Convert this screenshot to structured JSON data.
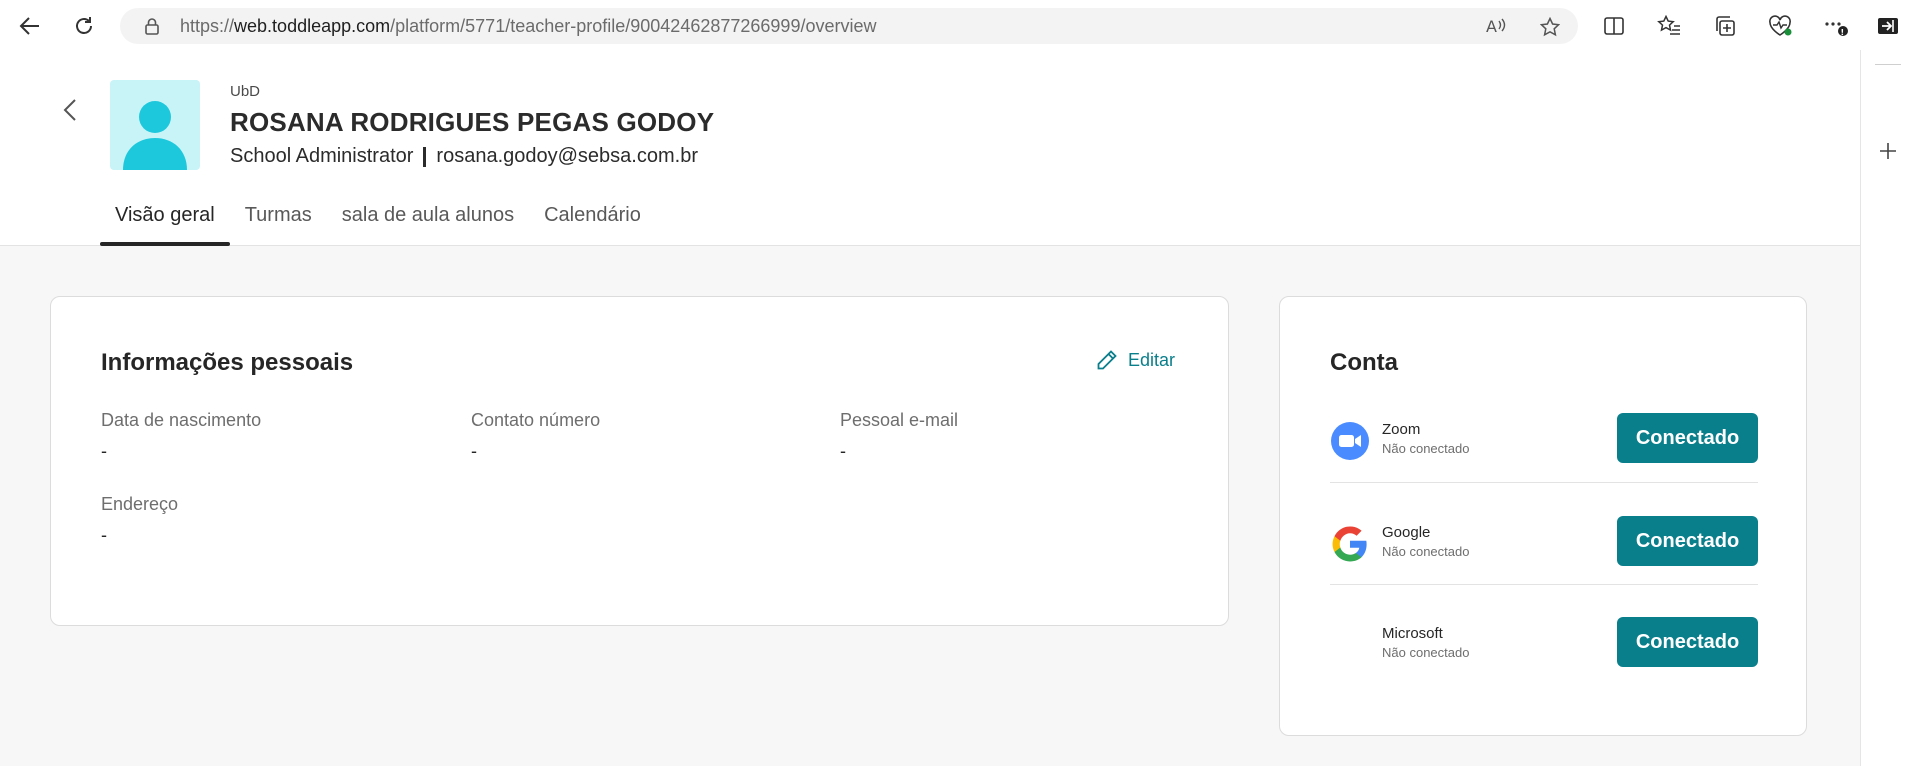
{
  "browser": {
    "url_prefix": "https://",
    "url_host": "web.toddleapp.com",
    "url_path": "/platform/5771/teacher-profile/90042462877266999/overview"
  },
  "profile": {
    "org": "UbD",
    "name": "ROSANA RODRIGUES PEGAS GODOY",
    "role": "School Administrator",
    "email": "rosana.godoy@sebsa.com.br"
  },
  "tabs": [
    {
      "label": "Visão geral",
      "active": true
    },
    {
      "label": "Turmas",
      "active": false
    },
    {
      "label": "sala de aula alunos",
      "active": false
    },
    {
      "label": "Calendário",
      "active": false
    }
  ],
  "personal": {
    "title": "Informações pessoais",
    "edit_label": "Editar",
    "fields": [
      {
        "label": "Data de nascimento",
        "value": "-"
      },
      {
        "label": "Contato número",
        "value": "-"
      },
      {
        "label": "Pessoal e-mail",
        "value": "-"
      },
      {
        "label": "Endereço",
        "value": "-"
      }
    ]
  },
  "account": {
    "title": "Conta",
    "items": [
      {
        "name": "Zoom",
        "status": "Não conectado",
        "button": "Conectado"
      },
      {
        "name": "Google",
        "status": "Não conectado",
        "button": "Conectado"
      },
      {
        "name": "Microsoft",
        "status": "Não conectado",
        "button": "Conectado"
      }
    ]
  },
  "colors": {
    "accent": "#0a7f8c",
    "avatar_bg": "#c8f4f8",
    "avatar_fg": "#1ec8dc",
    "zoom": "#4a8cff"
  }
}
